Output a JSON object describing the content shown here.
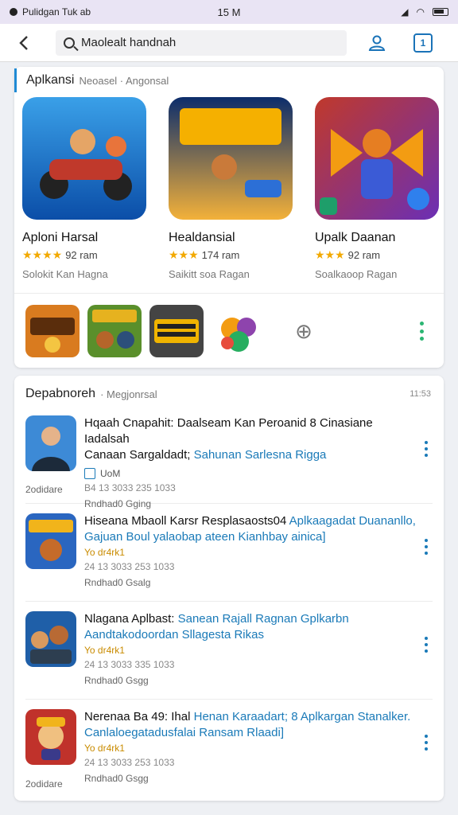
{
  "status": {
    "carrier": "Pulidgan Tuk ab",
    "time": "15 M"
  },
  "search": {
    "value": "Maolealt handnah"
  },
  "section1": {
    "title": "Aplkansi",
    "subtitle": "Neoasel · Angonsal",
    "apps": [
      {
        "name": "Aploni Harsal",
        "rating": "92 ram",
        "meta": "Solokit Kan Hagna"
      },
      {
        "name": "Healdansial",
        "rating": "174 ram",
        "meta": "Saikitt soa Ragan"
      },
      {
        "name": "Upalk Daanan",
        "rating": "92 ram",
        "meta": "Soalkaoop Ragan"
      }
    ]
  },
  "section2": {
    "title": "Depabnoreh",
    "subtitle": "· Megjonrsal",
    "count": "11:53",
    "items": [
      {
        "title": "Hqaah Cnapahit: Daalseam Kan Peroanid 8 Cinasiane Iadalsah",
        "title_link": "Sahunan Sarlesna Rigga",
        "title_prefix": "Canaan Sargaldadt;",
        "tag": "UoM",
        "stat": "B4 13 3033 235 1033",
        "date": "Rndhad0 Gging",
        "left": "2odidare"
      },
      {
        "title": "Hiseana Mbaoll Karsr Resplasaosts04",
        "title_link": "Aplkaagadat Duananllo,",
        "sub": "Gajuan Boul yalaobap ateen Kianhbay ainica]",
        "stars": "Yo dr4rk1",
        "stat": "24 13 3033 253 1033",
        "date": "Rndhad0 Gsalg"
      },
      {
        "title": "Nlagana Aplbast:",
        "title_link": "Sanean Rajall Ragnan Gplkarbn",
        "sub": "Aandtakodoordan Sllagesta Rikas",
        "stars": "Yo dr4rk1",
        "stat": "24 13 3033 335 1033",
        "date": "Rndhad0 Gsgg"
      },
      {
        "title": "Nerenaa Ba 49: Ihal",
        "title_link": "Henan Karaadart; 8 Aplkargan Stanalker.",
        "sub": "Canlaloegatadusfalai Ransam Rlaadi]",
        "stars": "Yo dr4rk1",
        "stat": "24 13 3033 253 1033",
        "date": "Rndhad0 Gsgg",
        "left": "2odidare"
      }
    ]
  },
  "colors": {
    "accent": "#1a7ab8",
    "star": "#f2a900",
    "statusbar": "#e9e4f4",
    "more": "#2bb673"
  }
}
